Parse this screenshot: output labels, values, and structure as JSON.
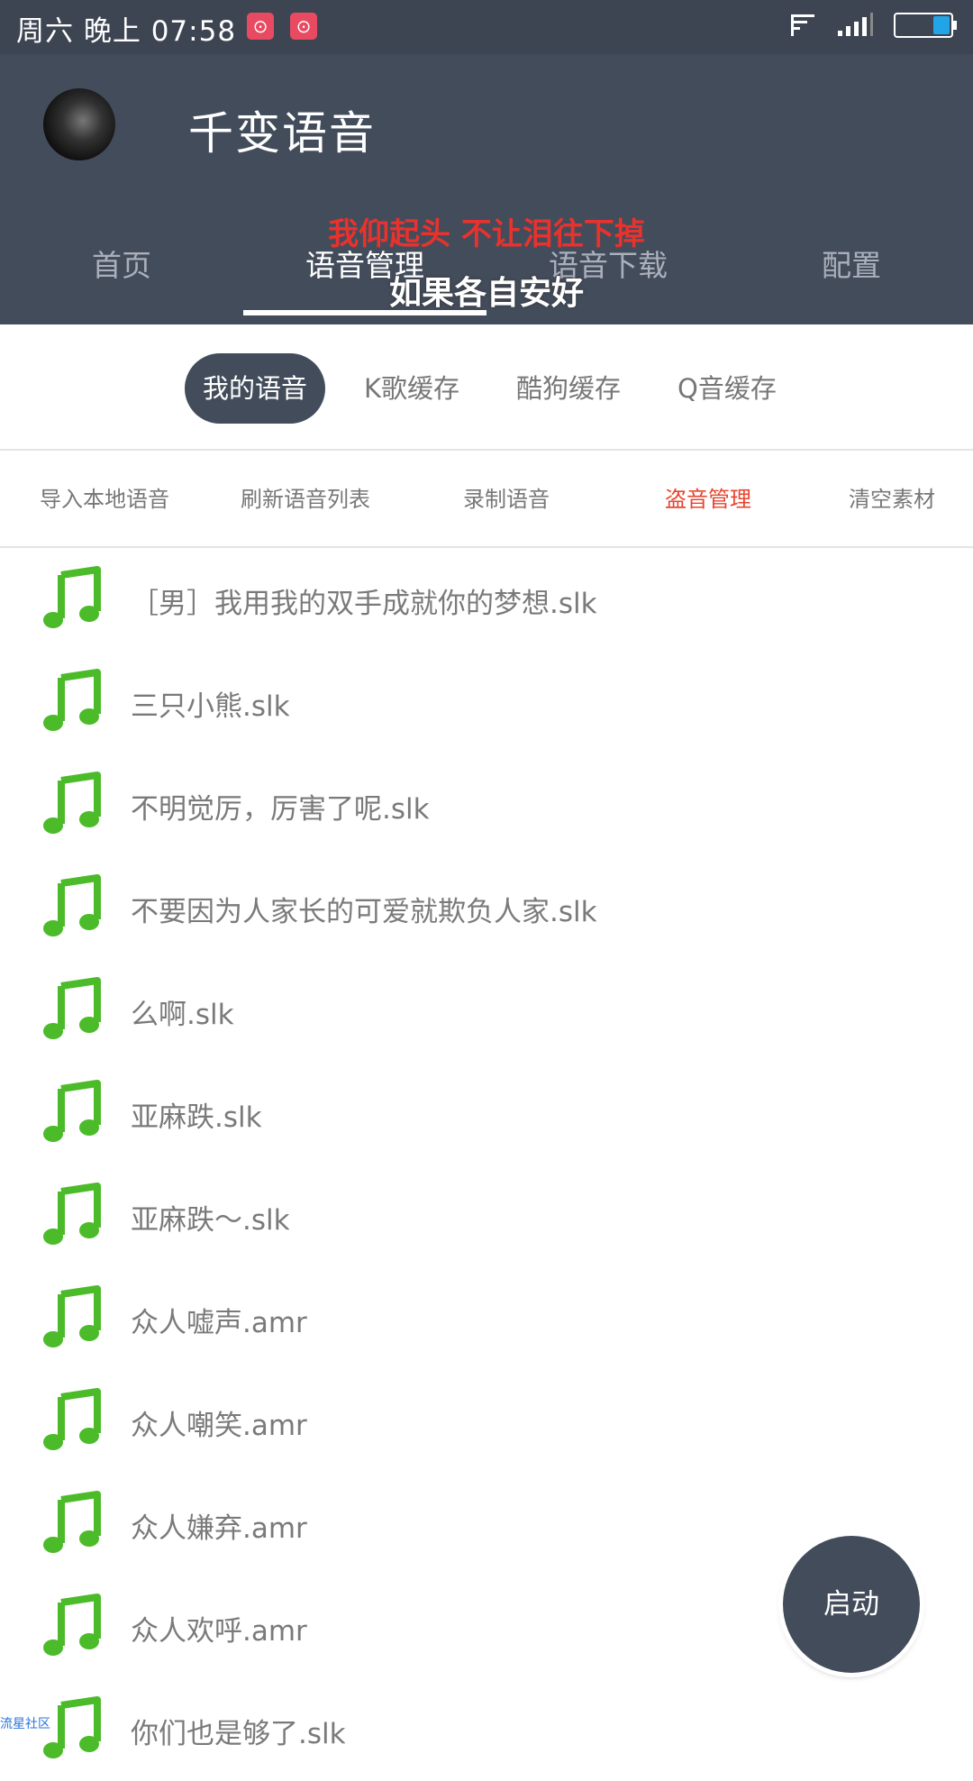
{
  "status_bar": {
    "time": "周六 晚上 07:58",
    "app_icons": [
      "netease-music-icon",
      "netease-music-icon"
    ],
    "right_icons": [
      "nfc-icon",
      "signal-icon",
      "battery-icon"
    ],
    "battery_color": "#21a5e8"
  },
  "header": {
    "title": "千变语音",
    "avatar_icon": "avatar",
    "background": "#434c5b"
  },
  "tabs": [
    {
      "label": "首页"
    },
    {
      "label": "语音管理",
      "active": true
    },
    {
      "label": "语音下载"
    },
    {
      "label": "配置"
    }
  ],
  "lyrics": {
    "line1": "我仰起头 不让泪往下掉",
    "line2": "如果各自安好",
    "line1_color": "#e8322d"
  },
  "chips": [
    {
      "label": "我的语音",
      "active": true
    },
    {
      "label": "K歌缓存"
    },
    {
      "label": "酷狗缓存"
    },
    {
      "label": "Q音缓存"
    }
  ],
  "actions": [
    {
      "label": "导入本地语音"
    },
    {
      "label": "刷新语音列表"
    },
    {
      "label": "录制语音"
    },
    {
      "label": "盗音管理",
      "highlight": true
    },
    {
      "label": "清空素材"
    }
  ],
  "files": [
    "［男］我用我的双手成就你的梦想.slk",
    "三只小熊.slk",
    "不明觉厉，厉害了呢.slk",
    "不要因为人家长的可爱就欺负人家.slk",
    "么啊.slk",
    "亚麻跌.slk",
    "亚麻跌～.slk",
    "众人嘘声.amr",
    "众人嘲笑.amr",
    "众人嫌弃.amr",
    "众人欢呼.amr",
    "你们也是够了.slk"
  ],
  "file_icon": "music-note-icon",
  "file_icon_color": "#4cbb2a",
  "fab": {
    "label": "启动"
  },
  "watermark": "流星社区"
}
